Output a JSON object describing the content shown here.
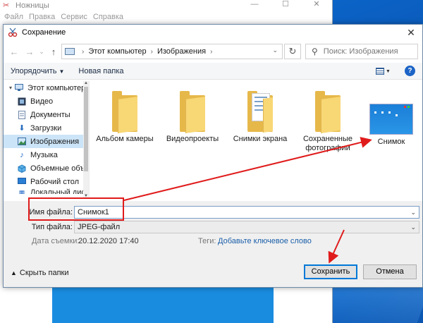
{
  "background_app": {
    "title": "Ножницы",
    "menu": [
      "Файл",
      "Правка",
      "Сервис",
      "Справка"
    ],
    "window_buttons": [
      "—",
      "☐",
      "✕"
    ]
  },
  "dialog": {
    "title": "Сохранение",
    "close_glyph": "✕",
    "nav": {
      "back": "←",
      "forward": "→",
      "down": "⌄",
      "up": "↑"
    },
    "address": {
      "crumbs": [
        "Этот компьютер",
        "Изображения"
      ],
      "sep": "›",
      "drop": "⌄"
    },
    "refresh_glyph": "↻",
    "search_placeholder": "Поиск: Изображения",
    "toolbar": {
      "organize": "Упорядочить",
      "new_folder": "Новая папка",
      "help": "?"
    },
    "sidebar": [
      {
        "label": "Этот компьютер",
        "icon": "computer-icon"
      },
      {
        "label": "Видео",
        "icon": "video-icon"
      },
      {
        "label": "Документы",
        "icon": "documents-icon"
      },
      {
        "label": "Загрузки",
        "icon": "downloads-icon"
      },
      {
        "label": "Изображения",
        "icon": "pictures-icon",
        "selected": true
      },
      {
        "label": "Музыка",
        "icon": "music-icon"
      },
      {
        "label": "Объемные объ",
        "icon": "3d-objects-icon"
      },
      {
        "label": "Рабочий стол",
        "icon": "desktop-icon"
      },
      {
        "label": "Локальный дис",
        "icon": "drive-icon"
      }
    ],
    "files": [
      {
        "label": "Альбом камеры",
        "type": "folder"
      },
      {
        "label": "Видеопроекты",
        "type": "folder"
      },
      {
        "label": "Снимки экрана",
        "type": "folder-with-content"
      },
      {
        "label": "Сохраненные фотографии",
        "type": "folder"
      },
      {
        "label": "Снимок",
        "type": "image"
      }
    ],
    "filename_label": "Имя файла:",
    "filename_value": "Снимок1",
    "filetype_label": "Тип файла:",
    "filetype_value": "JPEG-файл",
    "date_label": "Дата съемки:",
    "date_value": "20.12.2020 17:40",
    "tags_label": "Теги:",
    "tags_value": "Добавьте ключевое слово",
    "hide_folders": "Скрыть папки",
    "save_button": "Сохранить",
    "cancel_button": "Отмена"
  },
  "colors": {
    "accent": "#0078d7",
    "annotation": "#e01b1b",
    "folder": "#f8d775"
  }
}
